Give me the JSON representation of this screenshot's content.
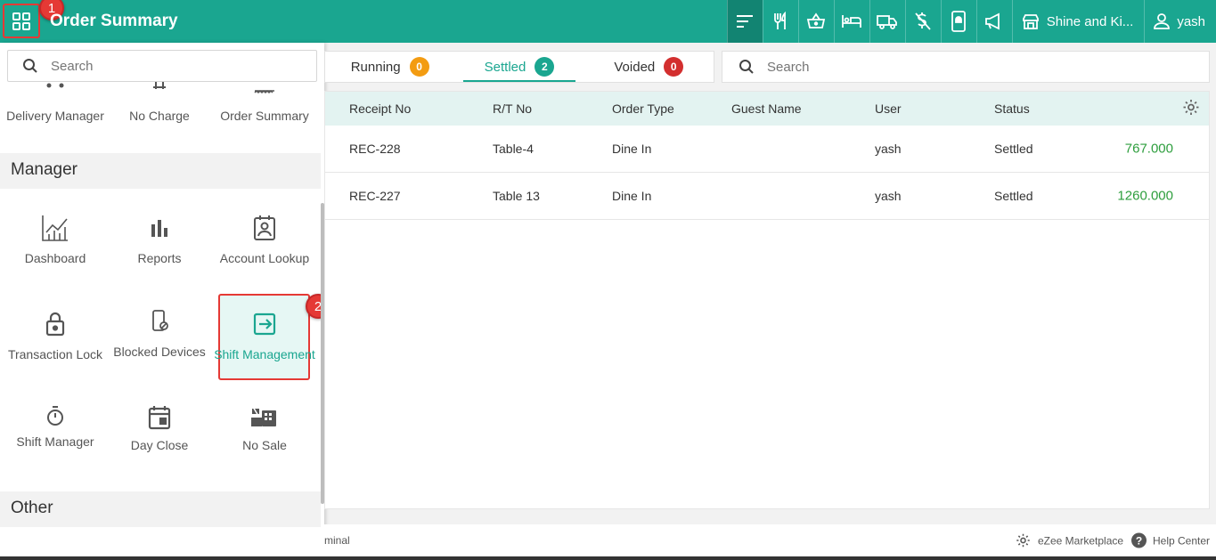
{
  "app": {
    "title": "Order Summary"
  },
  "badges": {
    "step1": "1",
    "step2": "2"
  },
  "topbar": {
    "outlet": "Shine and Ki...",
    "user": "yash",
    "icons": [
      "sort-icon",
      "restaurant-icon",
      "basket-icon",
      "bed-icon",
      "truck-icon",
      "no-charge-icon",
      "mobile-icon",
      "megaphone-icon",
      "store-icon",
      "user-icon"
    ]
  },
  "sidebar": {
    "search_placeholder": "Search",
    "top_items": [
      {
        "label": "Delivery Manager"
      },
      {
        "label": "No Charge"
      },
      {
        "label": "Order Summary"
      }
    ],
    "manager_heading": "Manager",
    "manager_items": [
      {
        "label": "Dashboard"
      },
      {
        "label": "Reports"
      },
      {
        "label": "Account Lookup"
      },
      {
        "label": "Transaction Lock"
      },
      {
        "label": "Blocked Devices"
      },
      {
        "label": "Shift Management"
      },
      {
        "label": "Shift Manager"
      },
      {
        "label": "Day Close"
      },
      {
        "label": "No Sale"
      }
    ],
    "other_heading": "Other"
  },
  "tabs": [
    {
      "label": "Running",
      "count": "0",
      "color": "#f39c12"
    },
    {
      "label": "Settled",
      "count": "2",
      "color": "#1aa690"
    },
    {
      "label": "Voided",
      "count": "0",
      "color": "#d32f2f"
    }
  ],
  "main_search_placeholder": "Search",
  "table": {
    "headers": [
      "Receipt No",
      "R/T No",
      "Order Type",
      "Guest Name",
      "User",
      "Status"
    ],
    "rows": [
      {
        "receipt": "REC-228",
        "rt": "Table-4",
        "type": "Dine In",
        "guest": "",
        "user": "yash",
        "status": "Settled",
        "amount": "767.000"
      },
      {
        "receipt": "REC-227",
        "rt": "Table 13",
        "type": "Dine In",
        "guest": "",
        "user": "yash",
        "status": "Settled",
        "amount": "1260.000"
      }
    ]
  },
  "footer": {
    "left_text": "minal",
    "marketplace": "eZee Marketplace",
    "help": "Help Center"
  },
  "colors": {
    "brand": "#1aa690",
    "highlight": "#e53935",
    "amount": "#2e9e3e"
  }
}
